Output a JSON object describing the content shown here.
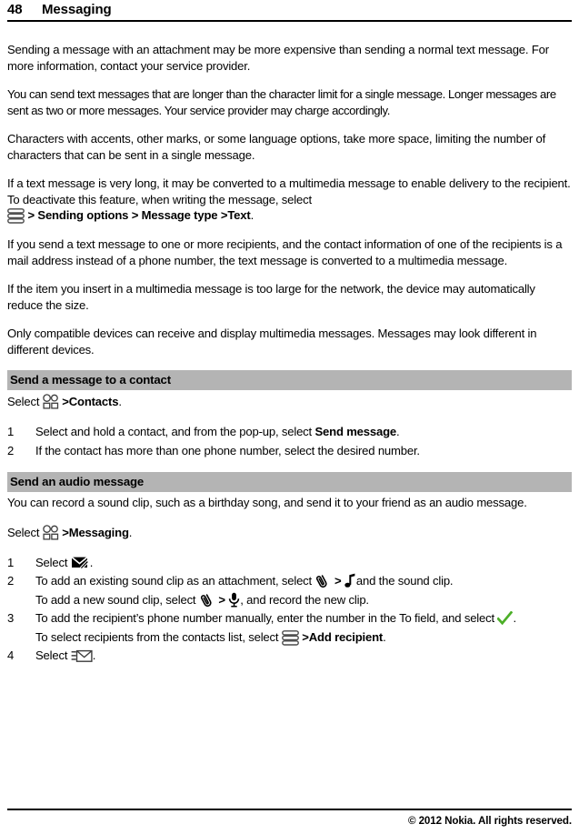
{
  "header": {
    "page_number": "48",
    "chapter": "Messaging"
  },
  "body": {
    "p1": "Sending a message with an attachment may be more expensive than sending a normal text message. For more information, contact your service provider.",
    "p2": "You can send text messages that are longer than the character limit for a single message. Longer messages are sent as two or more messages. Your service provider may charge accordingly.",
    "p3": "Characters with accents, other marks, or some language options, take more space, limiting the number of characters that can be sent in a single message.",
    "p4_before_icon": "If a text message is very long, it may be converted to a multimedia message to enable delivery to the recipient. To deactivate this feature, when writing the message, select",
    "p4_path_1": "Sending options",
    "p4_path_2": "Message type",
    "p4_path_3": "Text",
    "p4_end": ".",
    "p5": "If you send a text message to one or more recipients, and the contact information of one of the recipients is a mail address instead of a phone number, the text message is converted to a multimedia message.",
    "p6": "If the item you insert in a multimedia message is too large for the network, the device may automatically reduce the size.",
    "p7": "Only compatible devices can receive and display multimedia messages. Messages may look different in different devices."
  },
  "section_contact": {
    "heading": "Send a message to a contact",
    "select_label": "Select",
    "path_target": "Contacts",
    "period": ".",
    "steps": [
      {
        "number": "1",
        "text_before_bold": "Select and hold a contact, and from the pop-up, select ",
        "bold": "Send message",
        "text_after_bold": "."
      },
      {
        "number": "2",
        "text_before_bold": "If the contact has more than one phone number, select the desired number.",
        "bold": "",
        "text_after_bold": ""
      }
    ]
  },
  "section_audio": {
    "heading": "Send an audio message",
    "intro": "You can record a sound clip, such as a birthday song, and send it to your friend as an audio message.",
    "select_label": "Select",
    "path_target": "Messaging",
    "period": ".",
    "step1": {
      "number": "1",
      "select_label": "Select",
      "period": "."
    },
    "step2": {
      "number": "2",
      "line1_before": "To add an existing sound clip as an attachment, select",
      "line1_after": "and the sound clip.",
      "line2_before": "To add a new sound clip, select",
      "line2_after": ", and record the new clip."
    },
    "step3": {
      "number": "3",
      "line1": "To add the recipient’s phone number manually, enter the number in the To field, and select",
      "line1_end": ".",
      "line2_before": "To select recipients from the contacts list, select",
      "line2_bold": "Add recipient",
      "line2_end": "."
    },
    "step4": {
      "number": "4",
      "select_label": "Select",
      "period": "."
    }
  },
  "separator": ">",
  "icons": {
    "options_menu": "options-menu-icon",
    "app_menu": "app-menu-icon",
    "new_message": "new-message-icon",
    "attach": "paperclip-icon",
    "music_note": "music-note-icon",
    "microphone": "microphone-icon",
    "check": "green-check-icon",
    "send": "send-envelope-icon"
  },
  "colors": {
    "section_band": "#b4b4b4",
    "check_green": "#4caf28",
    "text": "#000000",
    "rule": "#000000"
  },
  "footer": {
    "copyright": "© 2012 Nokia. All rights reserved."
  }
}
